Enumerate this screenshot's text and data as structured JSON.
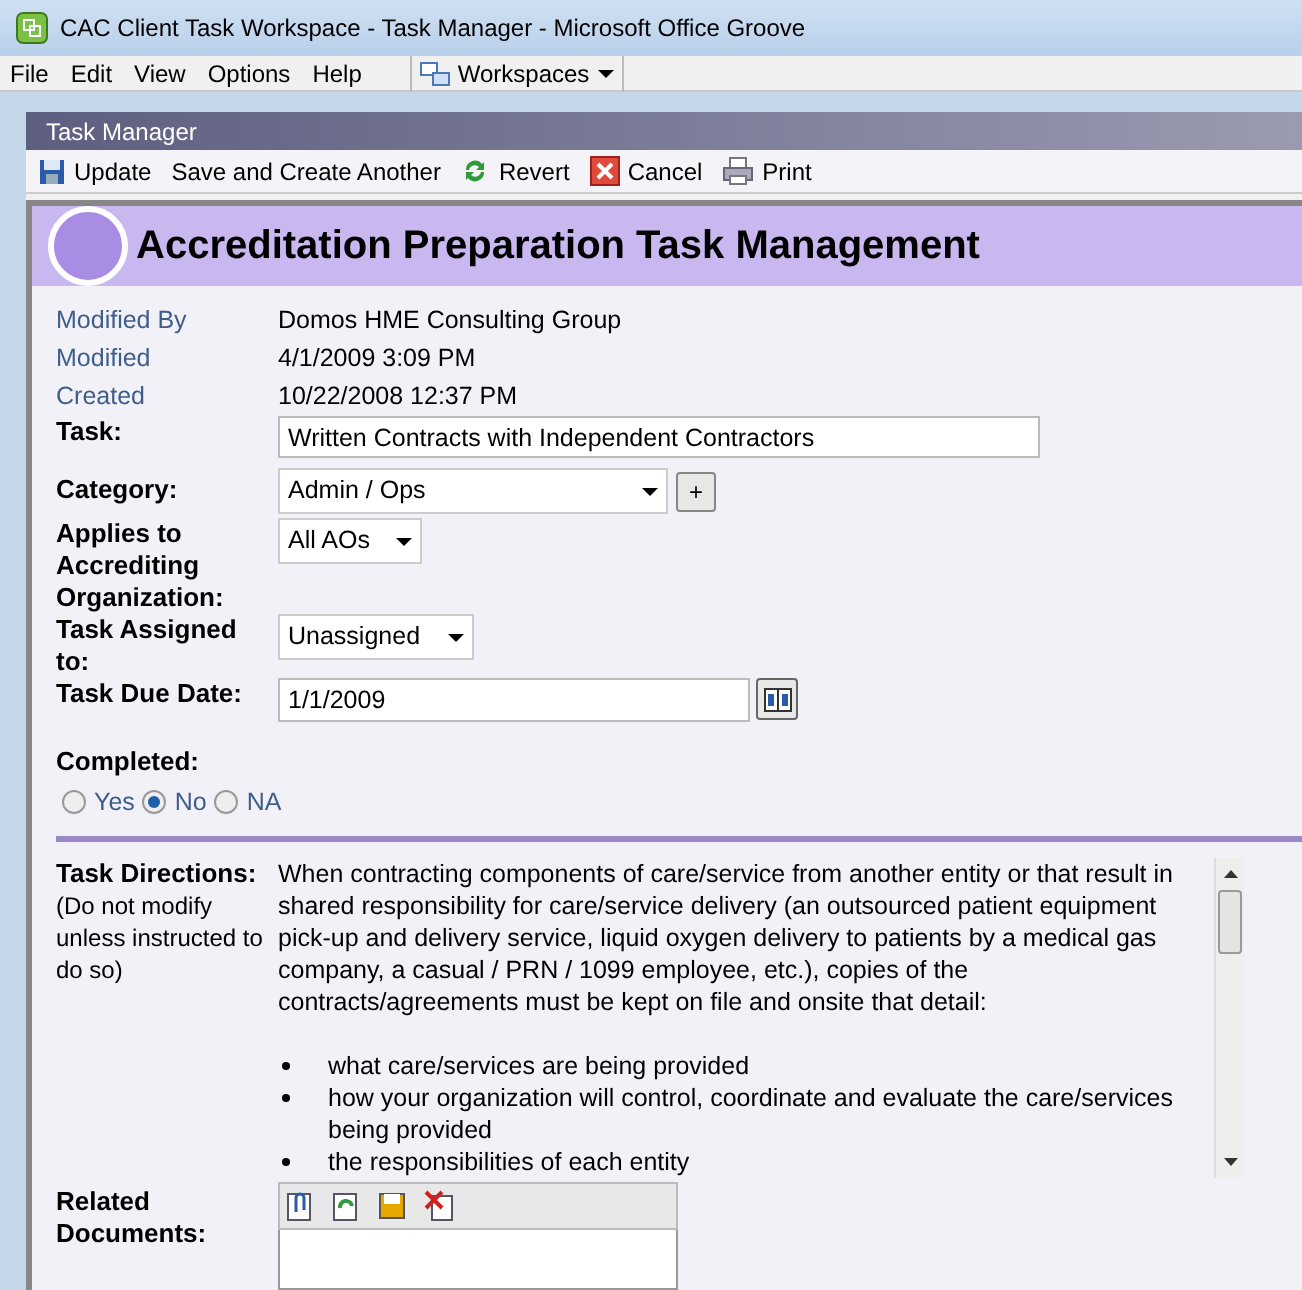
{
  "window": {
    "title": "CAC Client Task Workspace - Task Manager - Microsoft Office Groove"
  },
  "menu": [
    "File",
    "Edit",
    "View",
    "Options",
    "Help"
  ],
  "workspaces_button": "Workspaces",
  "panel": {
    "title": "Task Manager"
  },
  "toolbar": [
    {
      "kind": "save",
      "label": "Update"
    },
    {
      "kind": "plain",
      "label": "Save and Create Another"
    },
    {
      "kind": "revert",
      "label": "Revert"
    },
    {
      "kind": "cancel",
      "label": "Cancel"
    },
    {
      "kind": "print",
      "label": "Print"
    }
  ],
  "form": {
    "heading": "Accreditation Preparation Task Management",
    "meta": [
      {
        "label": "Modified By",
        "value": "Domos HME Consulting Group"
      },
      {
        "label": "Modified",
        "value": "4/1/2009 3:09 PM"
      },
      {
        "label": "Created",
        "value": "10/22/2008 12:37 PM"
      }
    ],
    "task": {
      "label": "Task:",
      "value": "Written Contracts with Independent Contractors"
    },
    "category": {
      "label": "Category:",
      "value": "Admin / Ops",
      "add": "+"
    },
    "applies_to": {
      "label": "Applies to Accrediting Organization:",
      "value": "All AOs"
    },
    "assigned_to": {
      "label": "Task Assigned to:",
      "value": "Unassigned"
    },
    "due_date": {
      "label": "Task Due Date:",
      "value": "1/1/2009"
    },
    "completed": {
      "label": "Completed:",
      "options": [
        {
          "label": "Yes",
          "selected": false
        },
        {
          "label": "No",
          "selected": true
        },
        {
          "label": "NA",
          "selected": false
        }
      ]
    },
    "directions": {
      "label": "Task Directions:",
      "note": "(Do not modify unless instructed to do so)",
      "text": "When contracting components of care/service from another entity or  that result in shared responsibility for care/service delivery (an outsourced patient equipment pick-up and delivery service, liquid oxygen delivery to patients by a medical gas company, a casual / PRN / 1099 employee, etc.), copies of the contracts/agreements must be kept on file and onsite that detail:",
      "bullets": [
        "what care/services are being provided",
        "how your organization will control, coordinate and evaluate the care/services being provided",
        "the responsibilities of each entity"
      ]
    },
    "related_documents": {
      "label": "Related Documents:"
    }
  }
}
